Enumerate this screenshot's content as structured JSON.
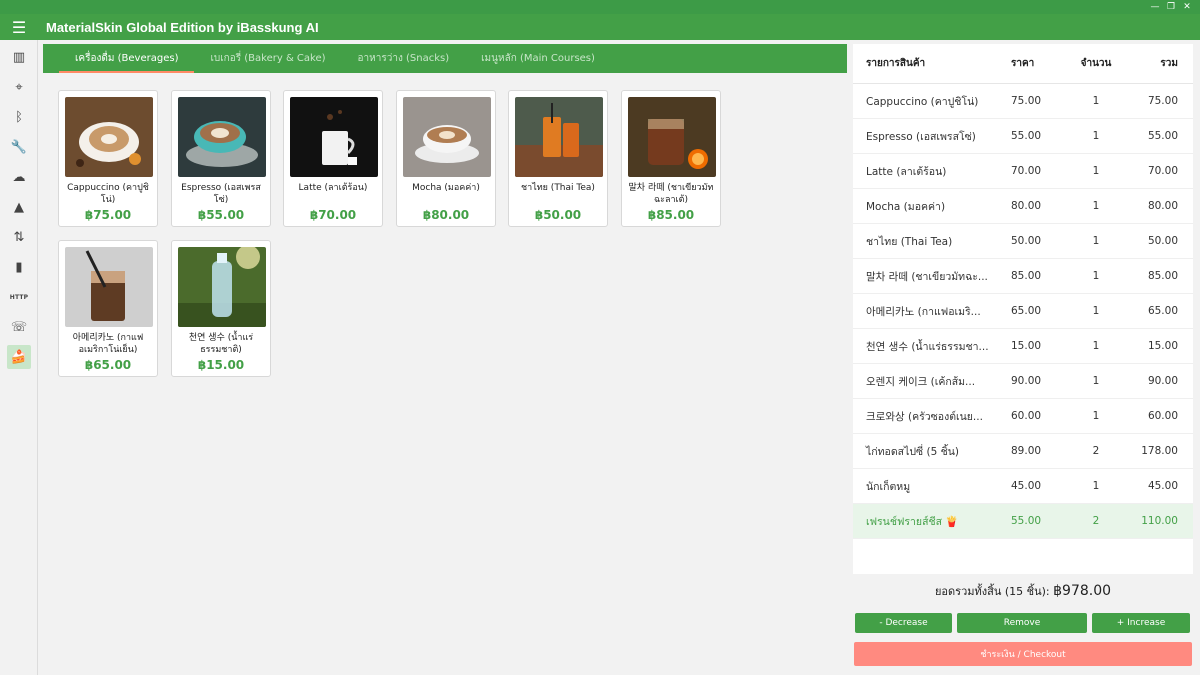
{
  "window": {
    "title": "MaterialSkin Global Edition by iBasskung AI",
    "controls": [
      "—",
      "❐",
      "✕"
    ]
  },
  "rail": [
    {
      "name": "chart-icon",
      "glyph": "▥"
    },
    {
      "name": "gps-icon",
      "glyph": "⌖"
    },
    {
      "name": "bluetooth-icon",
      "glyph": "ᛒ"
    },
    {
      "name": "wrench-icon",
      "glyph": "🔧"
    },
    {
      "name": "cloud-upload-icon",
      "glyph": "☁"
    },
    {
      "name": "warning-icon",
      "glyph": "▲"
    },
    {
      "name": "swap-vertical-icon",
      "glyph": "⇅"
    },
    {
      "name": "bookmark-icon",
      "glyph": "▮"
    },
    {
      "name": "http-icon",
      "glyph": "HTTP"
    },
    {
      "name": "phone-icon",
      "glyph": "☏"
    },
    {
      "name": "cake-icon",
      "glyph": "🍰"
    }
  ],
  "tabs": [
    {
      "label": "เครื่องดื่ม (Beverages)",
      "active": true
    },
    {
      "label": "เบเกอรี่ (Bakery & Cake)",
      "active": false
    },
    {
      "label": "อาหารว่าง (Snacks)",
      "active": false
    },
    {
      "label": "เมนูหลัก (Main Courses)",
      "active": false
    }
  ],
  "products": [
    {
      "name": "Cappuccino (คาปูชิโน่)",
      "price": "฿75.00",
      "img": "cappuccino"
    },
    {
      "name": "Espresso (เอสเพรสโซ่)",
      "price": "฿55.00",
      "img": "espresso"
    },
    {
      "name": "Latte (ลาเต้ร้อน)",
      "price": "฿70.00",
      "img": "latte"
    },
    {
      "name": "Mocha (มอคค่า)",
      "price": "฿80.00",
      "img": "mocha"
    },
    {
      "name": "ชาไทย (Thai Tea)",
      "price": "฿50.00",
      "img": "thaitea"
    },
    {
      "name": "말차 라떼 (ชาเขียวมัทฉะลาเต้)",
      "price": "฿85.00",
      "img": "matcha"
    },
    {
      "name": "아메리카노 (กาแฟอเมริกาโน่เย็น)",
      "price": "฿65.00",
      "img": "americano"
    },
    {
      "name": "천연 생수 (น้ำแร่ธรรมชาติ)",
      "price": "฿15.00",
      "img": "water"
    }
  ],
  "cart": {
    "headers": {
      "name": "รายการสินค้า",
      "price": "ราคา",
      "qty": "จำนวน",
      "total": "รวม"
    },
    "rows": [
      {
        "name": "Cappuccino (คาปูชิโน่)",
        "price": "75.00",
        "qty": "1",
        "total": "75.00"
      },
      {
        "name": "Espresso (เอสเพรสโซ่)",
        "price": "55.00",
        "qty": "1",
        "total": "55.00"
      },
      {
        "name": "Latte (ลาเต้ร้อน)",
        "price": "70.00",
        "qty": "1",
        "total": "70.00"
      },
      {
        "name": "Mocha (มอคค่า)",
        "price": "80.00",
        "qty": "1",
        "total": "80.00"
      },
      {
        "name": "ชาไทย (Thai Tea)",
        "price": "50.00",
        "qty": "1",
        "total": "50.00"
      },
      {
        "name": "말차 라떼 (ชาเขียวมัทฉะ...",
        "price": "85.00",
        "qty": "1",
        "total": "85.00"
      },
      {
        "name": "아메리카노 (กาแฟอเมริ...",
        "price": "65.00",
        "qty": "1",
        "total": "65.00"
      },
      {
        "name": "천연 생수 (น้ำแร่ธรรมชา...",
        "price": "15.00",
        "qty": "1",
        "total": "15.00"
      },
      {
        "name": "오렌지 케이크 (เค้กส้ม...",
        "price": "90.00",
        "qty": "1",
        "total": "90.00"
      },
      {
        "name": "크로와상 (ครัวซองต์เนย...",
        "price": "60.00",
        "qty": "1",
        "total": "60.00"
      },
      {
        "name": "ไก่ทอดสไปซี่ (5 ชิ้น)",
        "price": "89.00",
        "qty": "2",
        "total": "178.00"
      },
      {
        "name": "นักเก็ตหมู",
        "price": "45.00",
        "qty": "1",
        "total": "45.00"
      },
      {
        "name": "เฟรนช์ฟรายส์ชีส 🍟",
        "price": "55.00",
        "qty": "2",
        "total": "110.00",
        "selected": true
      }
    ]
  },
  "summary": {
    "label": "ยอดรวมทั้งสิ้น (15 ชิ้น):",
    "amount": "฿978.00"
  },
  "buttons": {
    "decrease": "- Decrease",
    "remove": "Remove",
    "increase": "+ Increase",
    "checkout": "ชำระเงิน / Checkout"
  },
  "colors": {
    "primary": "#43a047",
    "accent": "#ff8a65",
    "checkout": "#ff8a80",
    "selected_row": "#e8f5e9"
  }
}
